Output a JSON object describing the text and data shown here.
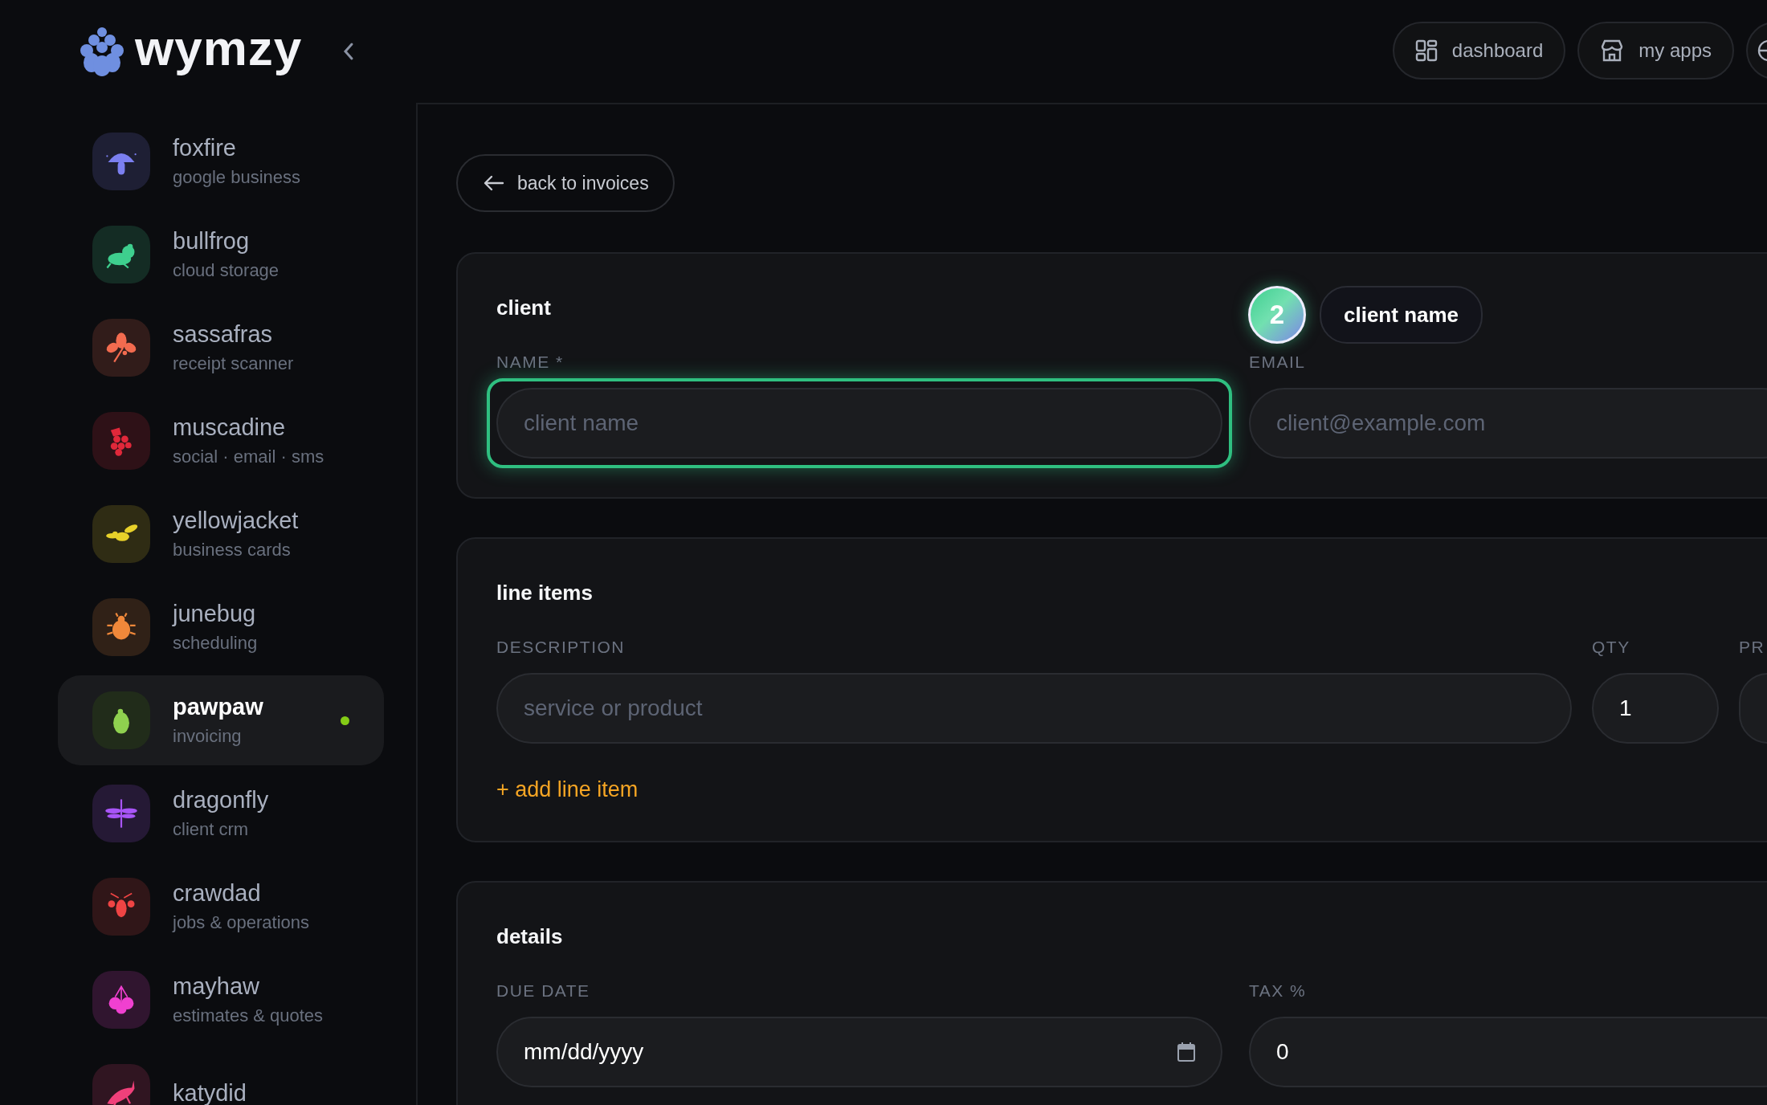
{
  "brand": {
    "name": "wymzy"
  },
  "sidebar": {
    "items": [
      {
        "name": "foxfire",
        "subtitle": "google business",
        "color": "#7b7ff0",
        "selected": false
      },
      {
        "name": "bullfrog",
        "subtitle": "cloud storage",
        "color": "#3ecf8e",
        "selected": false
      },
      {
        "name": "sassafras",
        "subtitle": "receipt scanner",
        "color": "#f26b4f",
        "selected": false
      },
      {
        "name": "muscadine",
        "subtitle": "social · email · sms",
        "color": "#e0283a",
        "selected": false
      },
      {
        "name": "yellowjacket",
        "subtitle": "business cards",
        "color": "#e8d12a",
        "selected": false
      },
      {
        "name": "junebug",
        "subtitle": "scheduling",
        "color": "#f0883a",
        "selected": false
      },
      {
        "name": "pawpaw",
        "subtitle": "invoicing",
        "color": "#8fd14f",
        "selected": true
      },
      {
        "name": "dragonfly",
        "subtitle": "client crm",
        "color": "#a855f7",
        "selected": false
      },
      {
        "name": "crawdad",
        "subtitle": "jobs & operations",
        "color": "#ef4444",
        "selected": false
      },
      {
        "name": "mayhaw",
        "subtitle": "estimates & quotes",
        "color": "#f040d0",
        "selected": false
      },
      {
        "name": "katydid",
        "color": "#f0407a",
        "selected": false
      }
    ]
  },
  "top_nav": [
    {
      "kind": "labeled",
      "label": "dashboard"
    },
    {
      "kind": "labeled",
      "label": "my apps"
    },
    {
      "kind": "icon_only"
    }
  ],
  "back_button": "back to invoices",
  "sections": [
    {
      "kind": "client",
      "title": "client",
      "fields": [
        {
          "label": "NAME *",
          "placeholder": "client name",
          "focused": true
        },
        {
          "label": "EMAIL",
          "placeholder": "client@example.com",
          "focused": false
        }
      ],
      "tour": {
        "step": "2",
        "label": "client name"
      }
    },
    {
      "kind": "line_items",
      "title": "line items",
      "fields": [
        {
          "label": "DESCRIPTION",
          "placeholder": "service or product",
          "focused": false
        },
        {
          "label": "QTY",
          "value": "1",
          "focused": false
        },
        {
          "label": "PR",
          "focused": false
        }
      ],
      "add_link": "+ add line item"
    },
    {
      "kind": "details",
      "title": "details",
      "fields": [
        {
          "label": "DUE DATE",
          "value": "mm/dd/yyyy",
          "kind": "date",
          "focused": false
        },
        {
          "label": "TAX %",
          "value": "0",
          "focused": false
        }
      ]
    }
  ]
}
